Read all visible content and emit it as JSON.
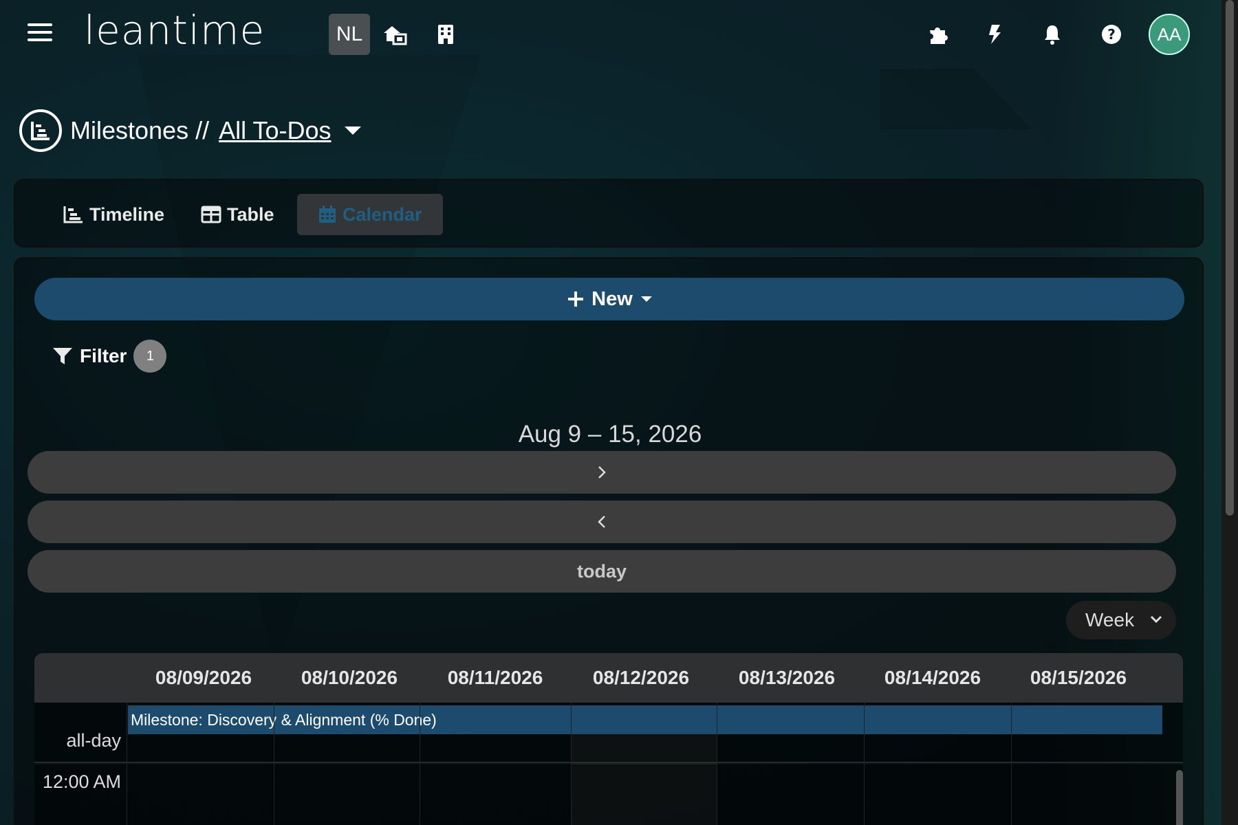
{
  "app": {
    "logo": "leantime"
  },
  "header": {
    "project_badge": "NL",
    "avatar_initials": "AA",
    "icons": [
      "home-building-icon",
      "building-icon",
      "puzzle-icon",
      "lightning-icon",
      "bell-icon",
      "help-icon"
    ]
  },
  "page": {
    "title": "Milestones //",
    "view_link": "All To-Dos"
  },
  "tabs": [
    {
      "label": "Timeline",
      "icon": "timeline-icon",
      "active": false
    },
    {
      "label": "Table",
      "icon": "table-icon",
      "active": false
    },
    {
      "label": "Calendar",
      "icon": "calendar-icon",
      "active": true
    }
  ],
  "toolbar": {
    "new_label": "New",
    "filter_label": "Filter",
    "filter_count": "1"
  },
  "calendar": {
    "range_title": "Aug 9 – 15, 2026",
    "next_label": "›",
    "prev_label": "‹",
    "today_label": "today",
    "view_select": "Week",
    "days": [
      "08/09/2026",
      "08/10/2026",
      "08/11/2026",
      "08/12/2026",
      "08/13/2026",
      "08/14/2026",
      "08/15/2026"
    ],
    "allday_label": "all-day",
    "first_time_label": "12:00 AM",
    "events": [
      {
        "title": "Milestone: Discovery & Alignment (% Done)",
        "color": "#1d4b6e"
      }
    ]
  },
  "colors": {
    "accent": "#1d4b6e",
    "avatar": "#3b9a7a",
    "active_tab_text": "#1f5f83"
  }
}
